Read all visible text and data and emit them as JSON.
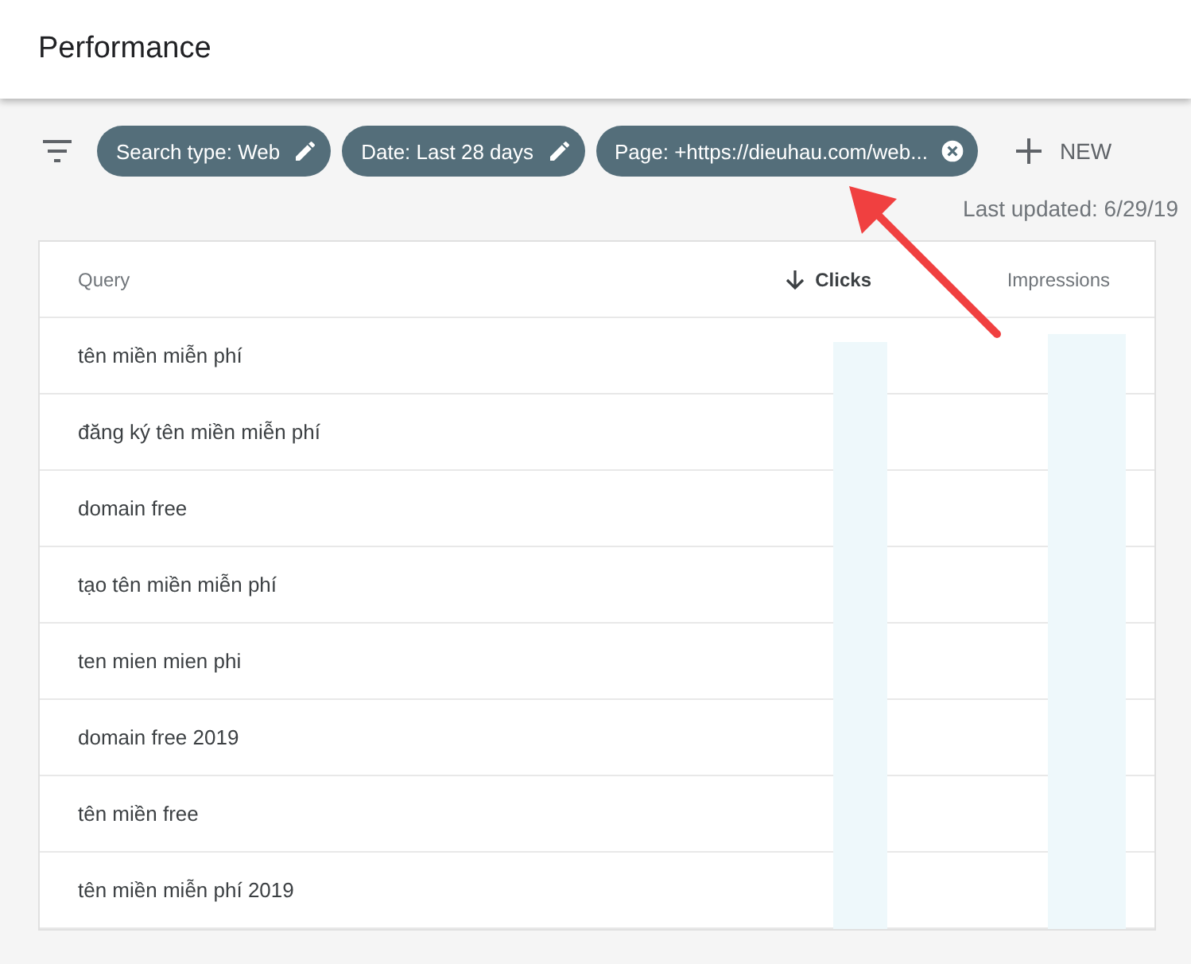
{
  "header": {
    "title": "Performance"
  },
  "filters": [
    {
      "label": "Search type: Web",
      "kind": "edit"
    },
    {
      "label": "Date: Last 28 days",
      "kind": "edit"
    },
    {
      "label": "Page: +https://dieuhau.com/web...",
      "kind": "remove"
    }
  ],
  "new_button": {
    "label": "NEW"
  },
  "last_updated": "Last updated: 6/29/19",
  "table": {
    "columns": [
      {
        "label": "Query",
        "sorted": false
      },
      {
        "label": "Clicks",
        "sorted": true
      },
      {
        "label": "Impressions",
        "sorted": false
      }
    ],
    "rows": [
      {
        "query": "tên miền miễn phí"
      },
      {
        "query": "đăng ký tên miền miễn phí"
      },
      {
        "query": "domain free"
      },
      {
        "query": "tạo tên miền miễn phí"
      },
      {
        "query": "ten mien mien phi"
      },
      {
        "query": "domain free 2019"
      },
      {
        "query": "tên miền free"
      },
      {
        "query": "tên miền miễn phí 2019"
      }
    ]
  }
}
